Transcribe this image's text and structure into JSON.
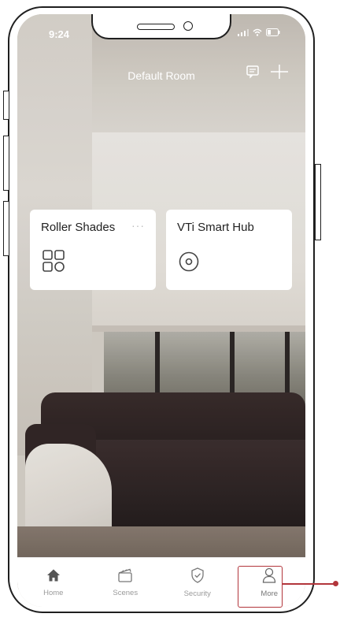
{
  "status_bar": {
    "time": "9:24"
  },
  "header": {
    "room_title": "Default Room",
    "message_icon": "message-icon",
    "add_icon": "plus-icon"
  },
  "cards": [
    {
      "title": "Roller Shades",
      "more": "···",
      "icon": "grid-icon"
    },
    {
      "title": "VTi Smart Hub",
      "more": "",
      "icon": "hub-disc-icon"
    }
  ],
  "tabbar": {
    "items": [
      {
        "label": "Home",
        "icon": "home-icon"
      },
      {
        "label": "Scenes",
        "icon": "clapperboard-icon"
      },
      {
        "label": "Security",
        "icon": "shield-check-icon"
      },
      {
        "label": "More",
        "icon": "person-icon"
      }
    ]
  },
  "colors": {
    "highlight": "#b2353b",
    "card_bg": "#ffffff",
    "tab_inactive": "#9a9a9a"
  }
}
